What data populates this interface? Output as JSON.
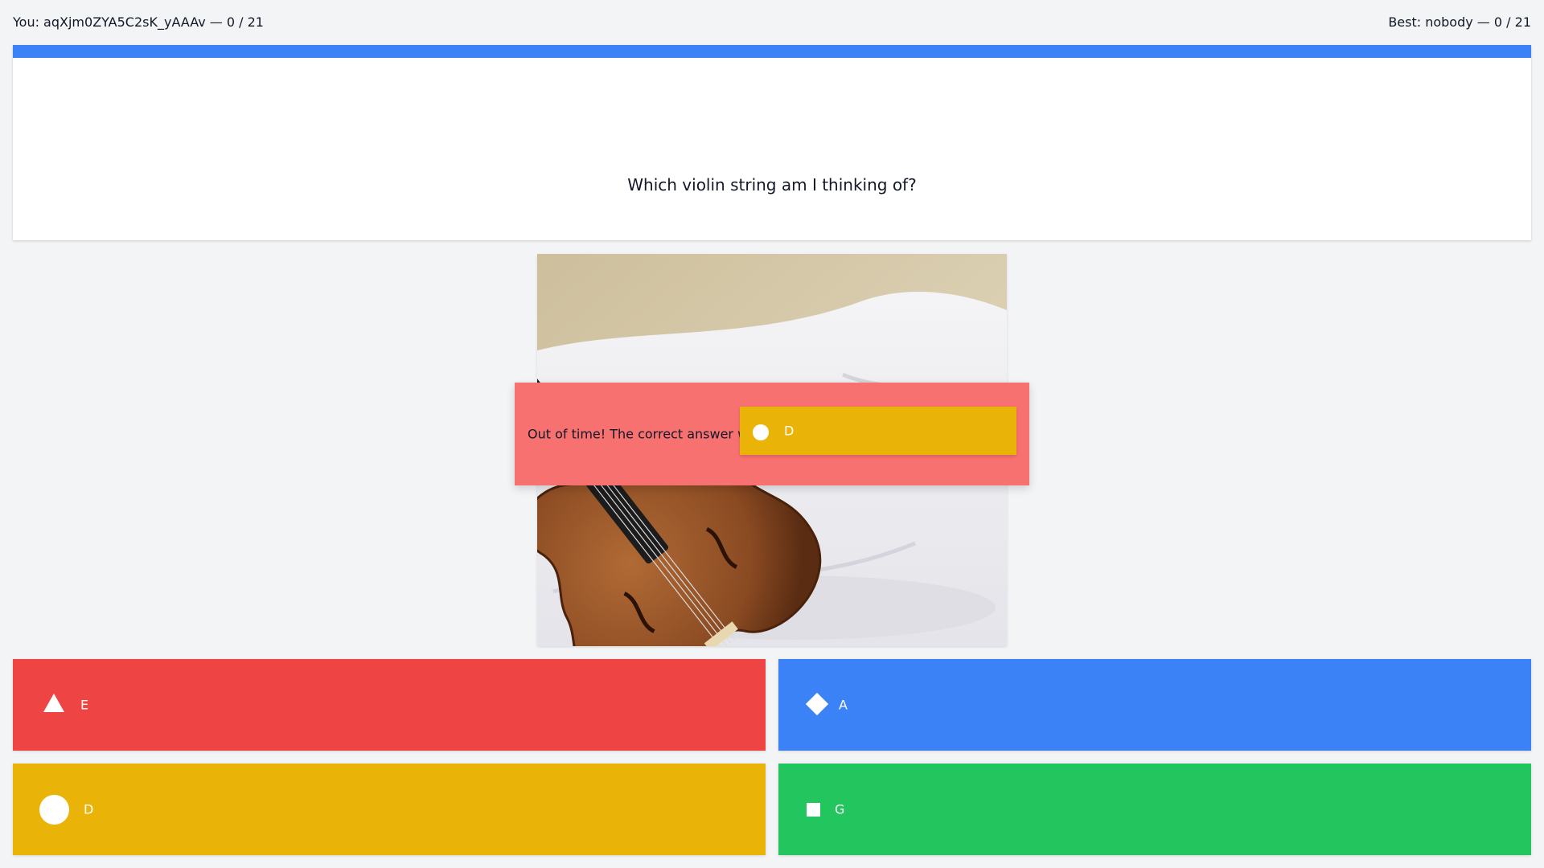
{
  "header": {
    "player_label": "You: aqXjm0ZYA5C2sK_yAAAv — 0 / 21",
    "best_label": "Best: nobody — 0 / 21"
  },
  "question": {
    "text": "Which violin string am I thinking of?",
    "image_icon": "violin-photo"
  },
  "result": {
    "message": "Out of time! The correct answer was",
    "answer_shape": "circle-icon",
    "answer_label": "D"
  },
  "answers": [
    {
      "shape": "triangle-icon",
      "label": "E",
      "color": "#ef4444"
    },
    {
      "shape": "diamond-icon",
      "label": "A",
      "color": "#3b82f6"
    },
    {
      "shape": "circle-icon",
      "label": "D",
      "color": "#eab308"
    },
    {
      "shape": "square-icon",
      "label": "G",
      "color": "#22c55e"
    }
  ],
  "colors": {
    "background": "#f3f4f6",
    "timer": "#3b82f6",
    "result_banner": "#f87171"
  }
}
